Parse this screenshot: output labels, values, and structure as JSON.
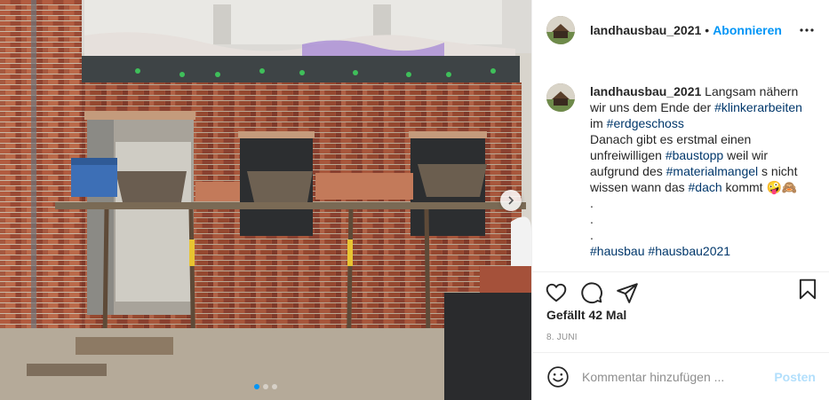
{
  "post": {
    "username": "landhausbau_2021",
    "separator": "•",
    "follow_label": "Abonnieren",
    "more_icon": "more-horizontal-icon",
    "caption": {
      "username": "landhausbau_2021",
      "lines": [
        [
          "Langsam nähern"
        ],
        [
          "wir uns dem Ende der ",
          "#klinkerarbeiten"
        ],
        [
          "im ",
          "#erdgeschoss"
        ],
        [
          "Danach gibt es erstmal einen"
        ],
        [
          "unfreiwilligen ",
          "#baustopp",
          " weil wir"
        ],
        [
          "aufgrund des ",
          "#materialmangel",
          " s nicht"
        ],
        [
          "wissen wann das ",
          "#dach",
          " kommt 🤪🙈"
        ],
        [
          "."
        ],
        [
          "."
        ],
        [
          "."
        ],
        [
          "#hausbau #hausbau2021"
        ]
      ],
      "l1": "Langsam nähern",
      "l2a": "wir uns dem Ende der ",
      "l2b": "#klinkerarbeiten",
      "l3a": "im ",
      "l3b": "#erdgeschoss",
      "l4": "Danach gibt es erstmal einen",
      "l5a": "unfreiwilligen ",
      "l5b": "#baustopp",
      "l5c": " weil wir",
      "l6a": "aufgrund des ",
      "l6b": "#materialmangel",
      "l6c": " s nicht",
      "l7a": "wissen wann das ",
      "l7b": "#dach",
      "l7c": " kommt 🤪🙈",
      "dot": ".",
      "l11a": "#hausbau",
      "l11b": "#hausbau2021"
    },
    "likes": "Gefällt 42 Mal",
    "date": "8. JUNI",
    "comment_placeholder": "Kommentar hinzufügen ...",
    "post_label": "Posten",
    "carousel": {
      "slides": 3,
      "active": 1
    },
    "colors": {
      "accent": "#0095f6",
      "hashtag": "#00376b",
      "post_disabled": "#b2dffc"
    }
  }
}
